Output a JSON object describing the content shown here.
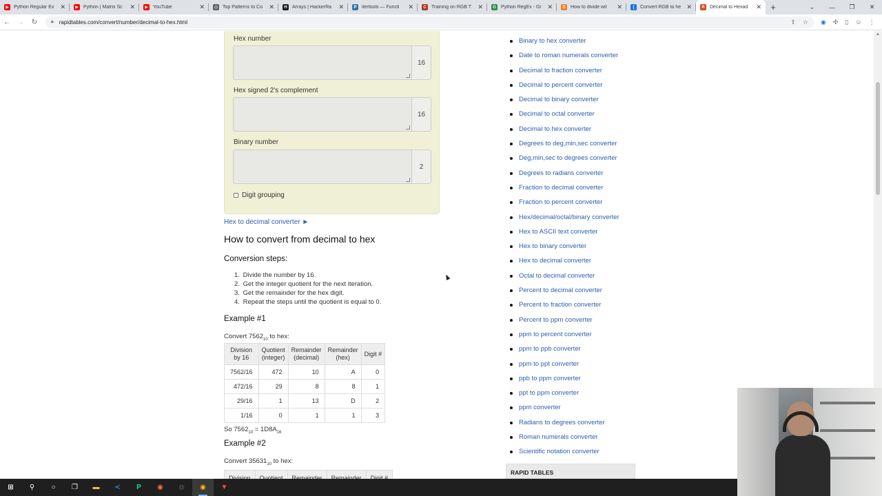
{
  "browser": {
    "tabs": [
      {
        "title": "Python Regular Ex",
        "icon": "youtube-icon",
        "color": "#ff0000",
        "glyph": "▶"
      },
      {
        "title": "Python | Matrix Sc",
        "icon": "youtube-icon",
        "color": "#ff0000",
        "glyph": "▶"
      },
      {
        "title": "YouTube",
        "icon": "youtube-icon",
        "color": "#ff0000",
        "glyph": "▶"
      },
      {
        "title": "Top Patterns to Co",
        "icon": "globe-icon",
        "color": "#5f6368",
        "glyph": "◎"
      },
      {
        "title": "Arrays | HackerRa",
        "icon": "hackerrank-icon",
        "color": "#1b1b1b",
        "glyph": "H"
      },
      {
        "title": "itertools — Functi",
        "icon": "python-icon",
        "color": "#3776ab",
        "glyph": "P"
      },
      {
        "title": "Training on RGB T",
        "icon": "codewars-icon",
        "color": "#b1361e",
        "glyph": "C"
      },
      {
        "title": "Python RegEx - Gr",
        "icon": "gfg-icon",
        "color": "#2f8d46",
        "glyph": "G"
      },
      {
        "title": "How to divide wit",
        "icon": "stackoverflow-icon",
        "color": "#f48024",
        "glyph": "S"
      },
      {
        "title": "Convert RGB to he",
        "icon": "json-icon",
        "color": "#1a73e8",
        "glyph": "{"
      },
      {
        "title": "Decimal to Hexad",
        "icon": "rapidtables-icon",
        "color": "#d2491b",
        "glyph": "R"
      }
    ],
    "new_tab": "+",
    "url": "rapidtables.com/convert/number/decimal-to-hex.html"
  },
  "converter": {
    "hex_label": "Hex number",
    "hex_base": "16",
    "hex2c_label": "Hex signed 2's complement",
    "hex2c_base": "16",
    "bin_label": "Binary number",
    "bin_base": "2",
    "grouping_label": "Digit grouping"
  },
  "article": {
    "back_link": "Hex to decimal converter ►",
    "title": "How to convert from decimal to hex",
    "steps_title": "Conversion steps:",
    "steps": [
      {
        "n": "1.",
        "text": "Divide the number by 16."
      },
      {
        "n": "2.",
        "text": "Get the integer quotient for the next iteration."
      },
      {
        "n": "3.",
        "text": "Get the remainder for the hex digit."
      },
      {
        "n": "4.",
        "text": "Repeat the steps until the quotient is equal to 0."
      }
    ],
    "example1": {
      "title": "Example #1",
      "convert_prefix": "Convert 7562",
      "convert_sub": "10",
      "convert_suffix": " to hex:",
      "headers": [
        [
          "Division",
          "by 16"
        ],
        [
          "Quotient",
          "(integer)"
        ],
        [
          "Remainder",
          "(decimal)"
        ],
        [
          "Remainder",
          "(hex)"
        ],
        [
          "Digit #",
          ""
        ]
      ],
      "rows": [
        [
          "7562/16",
          "472",
          "10",
          "A",
          "0"
        ],
        [
          "472/16",
          "29",
          "8",
          "8",
          "1"
        ],
        [
          "29/16",
          "1",
          "13",
          "D",
          "2"
        ],
        [
          "1/16",
          "0",
          "1",
          "1",
          "3"
        ]
      ],
      "result_prefix": "So 7562",
      "result_sub1": "10",
      "result_mid": " = 1D8A",
      "result_sub2": "16"
    },
    "example2": {
      "title": "Example #2",
      "convert_prefix": "Convert 35631",
      "convert_sub": "10",
      "convert_suffix": " to hex:",
      "headers": [
        "Division",
        "Quotient",
        "Remainder",
        "Remainder",
        "Digit #"
      ]
    }
  },
  "sidebar": {
    "links": [
      "Binary to hex converter",
      "Date to roman numerals converter",
      "Decimal to fraction converter",
      "Decimal to percent converter",
      "Decimal to binary converter",
      "Decimal to octal converter",
      "Decimal to hex converter",
      "Degrees to deg,min,sec converter",
      "Deg,min,sec to degrees converter",
      "Degrees to radians converter",
      "Fraction to decimal converter",
      "Fraction to percent converter",
      "Hex/decimal/octal/binary converter",
      "Hex to ASCII text converter",
      "Hex to binary converter",
      "Hex to decimal converter",
      "Octal to decimal converter",
      "Percent to decimal converter",
      "Percent to fraction converter",
      "Percent to ppm converter",
      "ppm to percent converter",
      "ppm to ppb converter",
      "ppm to ppt converter",
      "ppb to ppm converter",
      "ppt to ppm converter",
      "ppm converter",
      "Radians to degrees converter",
      "Roman numerals converter",
      "Scientific notation converter"
    ],
    "rapid_tables": "RAPID TABLES"
  },
  "taskbar": {
    "items": [
      {
        "icon": "windows-start-icon",
        "color": "#ffffff",
        "glyph": "⊞"
      },
      {
        "icon": "search-icon",
        "color": "#ffffff",
        "glyph": "⚲"
      },
      {
        "icon": "cortana-icon",
        "color": "#ffffff",
        "glyph": "○"
      },
      {
        "icon": "task-view-icon",
        "color": "#ffffff",
        "glyph": "❐"
      },
      {
        "icon": "file-explorer-icon",
        "color": "#f2c14e",
        "glyph": "▬"
      },
      {
        "icon": "vscode-icon",
        "color": "#2b8bd6",
        "glyph": "≺"
      },
      {
        "icon": "pycharm-icon",
        "color": "#21d789",
        "glyph": "P"
      },
      {
        "icon": "firefox-icon",
        "color": "#ff7139",
        "glyph": "◉"
      },
      {
        "icon": "obs-icon",
        "color": "#555555",
        "glyph": "◍"
      },
      {
        "icon": "chrome-icon",
        "color": "#fbbc05",
        "glyph": "◉"
      },
      {
        "icon": "brave-icon",
        "color": "#fb542b",
        "glyph": "▼"
      }
    ],
    "active_index": 9
  }
}
